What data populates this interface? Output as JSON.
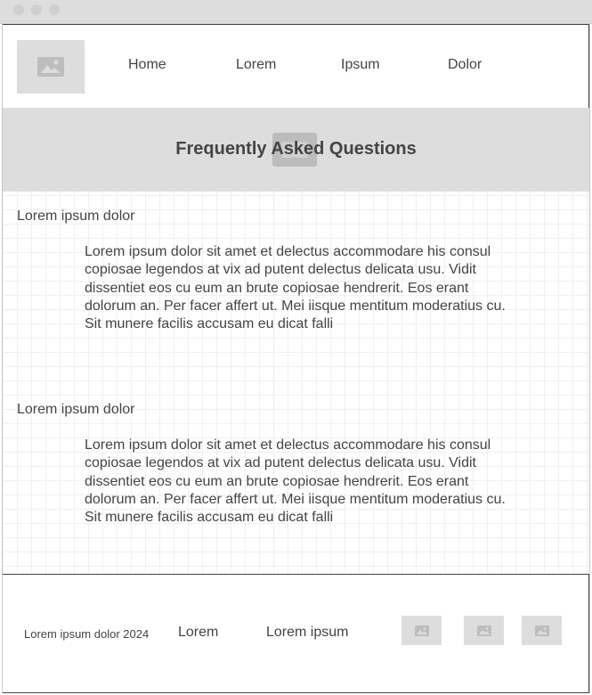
{
  "nav": {
    "items": [
      {
        "label": "Home"
      },
      {
        "label": "Lorem"
      },
      {
        "label": "Ipsum"
      },
      {
        "label": "Dolor"
      }
    ]
  },
  "hero": {
    "title": "Frequently Asked Questions"
  },
  "faq": [
    {
      "question": "Lorem ipsum dolor",
      "answer": "Lorem ipsum dolor sit amet et delectus accommodare his consul copiosae legendos at vix ad putent delectus delicata usu. Vidit dissentiet eos cu eum an brute copiosae hendrerit. Eos erant dolorum an. Per facer affert ut. Mei iisque mentitum moderatius cu. Sit munere facilis accusam eu dicat falli"
    },
    {
      "question": "Lorem ipsum dolor",
      "answer": "Lorem ipsum dolor sit amet et delectus accommodare his consul copiosae legendos at vix ad putent delectus delicata usu. Vidit dissentiet eos cu eum an brute copiosae hendrerit. Eos erant dolorum an. Per facer affert ut. Mei iisque mentitum moderatius cu. Sit munere facilis accusam eu dicat falli"
    }
  ],
  "footer": {
    "copyright": "Lorem ipsum dolor 2024",
    "links": [
      {
        "label": "Lorem"
      },
      {
        "label": "Lorem ipsum"
      }
    ],
    "social_icons": [
      "image-placeholder-icon",
      "image-placeholder-icon",
      "image-placeholder-icon"
    ]
  },
  "colors": {
    "chrome": "#dddddd",
    "placeholder": "#dddddd",
    "text": "#444444",
    "grid": "#f0f0f0"
  }
}
